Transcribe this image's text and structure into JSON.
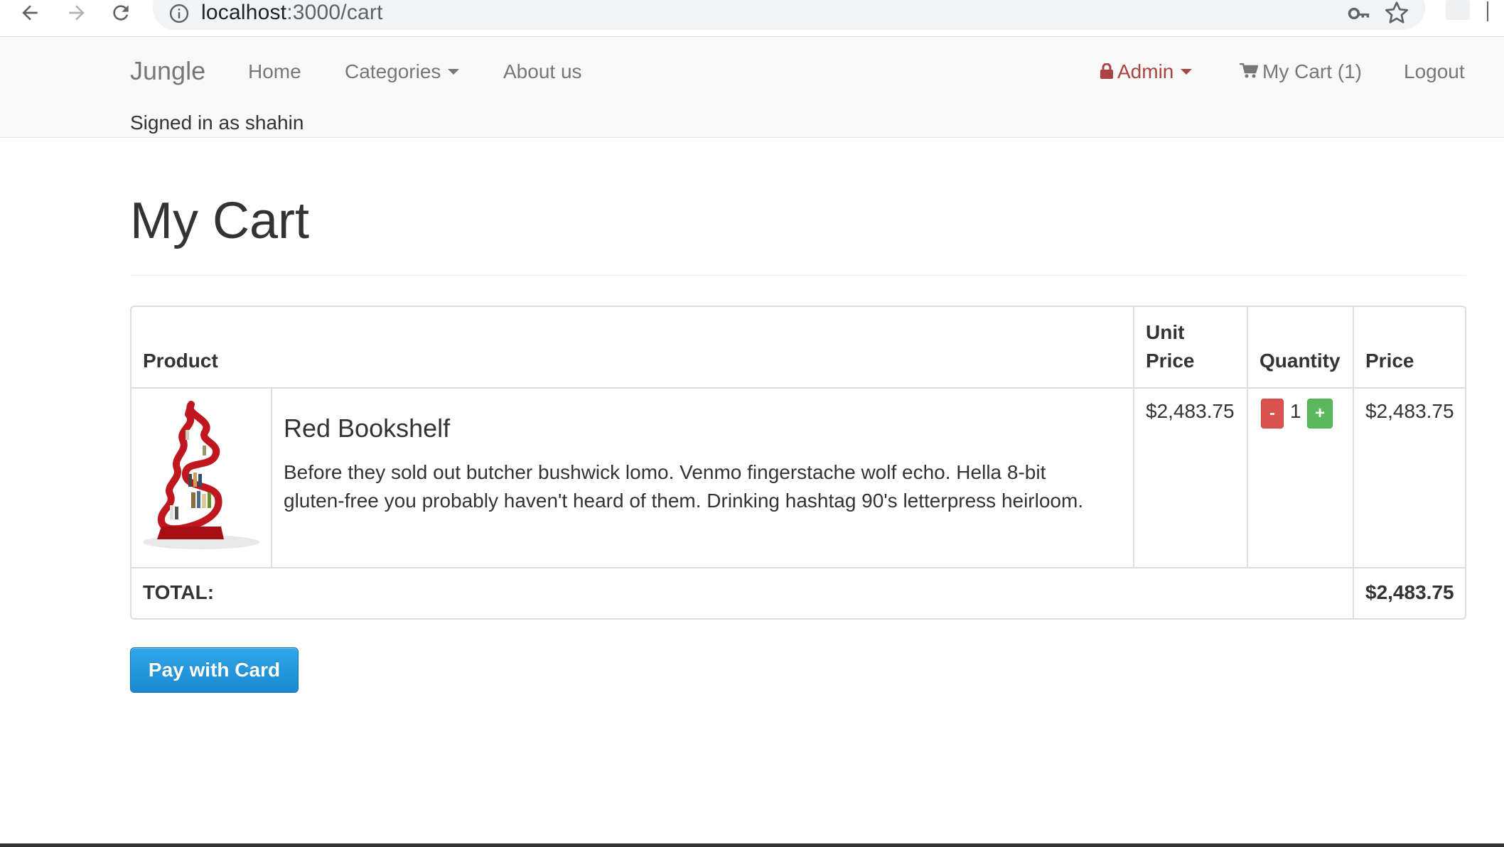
{
  "browser": {
    "url_host": "localhost",
    "url_path": ":3000/cart"
  },
  "navbar": {
    "brand": "Jungle",
    "home": "Home",
    "categories": "Categories",
    "about": "About us",
    "admin": "Admin",
    "cart": "My Cart (1)",
    "logout": "Logout",
    "signed_in": "Signed in as shahin",
    "admin_color": "#a94442"
  },
  "page": {
    "title": "My Cart"
  },
  "cart": {
    "headers": {
      "product": "Product",
      "unit_price_line1": "Unit",
      "unit_price_line2": "Price",
      "quantity": "Quantity",
      "price": "Price"
    },
    "items": [
      {
        "name": "Red Bookshelf",
        "description": "Before they sold out butcher bushwick lomo. Venmo fingerstache wolf echo. Hella 8-bit gluten-free you probably haven't heard of them. Drinking hashtag 90's letterpress heirloom.",
        "unit_price": "$2,483.75",
        "quantity": "1",
        "minus_label": "-",
        "plus_label": "+",
        "price": "$2,483.75"
      }
    ],
    "total_label": "TOTAL:",
    "total_value": "$2,483.75"
  },
  "pay_button": "Pay with Card",
  "icons": [
    "back-arrow-icon",
    "forward-arrow-icon",
    "reload-icon",
    "info-icon",
    "key-icon",
    "star-icon",
    "lock-icon",
    "cart-icon",
    "chevron-down-icon"
  ]
}
